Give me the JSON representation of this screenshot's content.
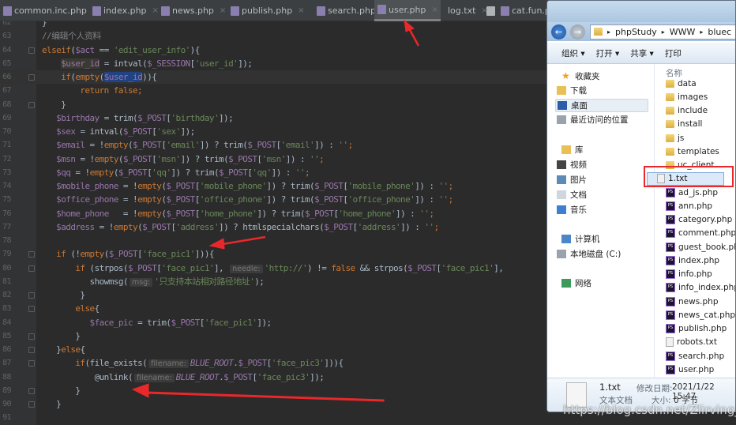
{
  "editor": {
    "tabs": [
      {
        "label": "common.inc.php",
        "type": "php",
        "active": false
      },
      {
        "label": "index.php",
        "type": "php",
        "active": false
      },
      {
        "label": "news.php",
        "type": "php",
        "active": false
      },
      {
        "label": "publish.php",
        "type": "php",
        "active": false
      },
      {
        "label": "search.php",
        "type": "php",
        "active": false
      },
      {
        "label": "user.php",
        "type": "php",
        "active": true
      },
      {
        "label": "log.txt",
        "type": "txt",
        "active": false
      },
      {
        "label": "cat.fun.p",
        "type": "php",
        "active": false
      }
    ],
    "current_line": 66,
    "lines": [
      {
        "n": "62",
        "t": [
          [
            "",
            "}"
          ]
        ]
      },
      {
        "n": "63",
        "t": [
          [
            "cm",
            "//编辑个人资料"
          ]
        ]
      },
      {
        "n": "64",
        "t": [
          [
            "kw",
            "elseif"
          ],
          [
            "",
            "("
          ],
          [
            "var",
            "$act"
          ],
          [
            "",
            " == "
          ],
          [
            "str",
            "'edit_user_info'"
          ],
          [
            "",
            "){"
          ]
        ]
      },
      {
        "n": "65",
        "t": [
          [
            "",
            "    "
          ],
          [
            "uvar",
            "$user_id"
          ],
          [
            "",
            " = intval("
          ],
          [
            "var",
            "$_SESSION"
          ],
          [
            "",
            "["
          ],
          [
            "str",
            "'user_id'"
          ],
          [
            "",
            "]);"
          ]
        ]
      },
      {
        "n": "66",
        "t": [
          [
            "",
            "    "
          ],
          [
            "kw",
            "if"
          ],
          [
            "",
            "("
          ],
          [
            "kw",
            "empty"
          ],
          [
            "",
            "("
          ],
          [
            "sel var",
            "$user_id"
          ],
          [
            "",
            ")){"
          ]
        ]
      },
      {
        "n": "67",
        "t": [
          [
            "",
            "        "
          ],
          [
            "kw",
            "return false;"
          ]
        ]
      },
      {
        "n": "68",
        "t": [
          [
            "",
            "    }"
          ]
        ]
      },
      {
        "n": "69",
        "t": [
          [
            "",
            "   "
          ],
          [
            "var",
            "$birthday"
          ],
          [
            "",
            " = trim("
          ],
          [
            "var",
            "$_POST"
          ],
          [
            "",
            "["
          ],
          [
            "str",
            "'birthday'"
          ],
          [
            "",
            "]);"
          ]
        ]
      },
      {
        "n": "70",
        "t": [
          [
            "",
            "   "
          ],
          [
            "var",
            "$sex"
          ],
          [
            "",
            " = intval("
          ],
          [
            "var",
            "$_POST"
          ],
          [
            "",
            "["
          ],
          [
            "str",
            "'sex'"
          ],
          [
            "",
            "]);"
          ]
        ]
      },
      {
        "n": "71",
        "t": [
          [
            "",
            "   "
          ],
          [
            "var",
            "$email"
          ],
          [
            "",
            " = !"
          ],
          [
            "kw",
            "empty"
          ],
          [
            "",
            "("
          ],
          [
            "var",
            "$_POST"
          ],
          [
            "",
            "["
          ],
          [
            "str",
            "'email'"
          ],
          [
            "",
            "]) ? trim("
          ],
          [
            "var",
            "$_POST"
          ],
          [
            "",
            "["
          ],
          [
            "str",
            "'email'"
          ],
          [
            "",
            "]) : "
          ],
          [
            "str",
            "''"
          ],
          [
            "kw",
            ";"
          ]
        ]
      },
      {
        "n": "72",
        "t": [
          [
            "",
            "   "
          ],
          [
            "var",
            "$msn"
          ],
          [
            "",
            " = !"
          ],
          [
            "kw",
            "empty"
          ],
          [
            "",
            "("
          ],
          [
            "var",
            "$_POST"
          ],
          [
            "",
            "["
          ],
          [
            "str",
            "'msn'"
          ],
          [
            "",
            "]) ? trim("
          ],
          [
            "var",
            "$_POST"
          ],
          [
            "",
            "["
          ],
          [
            "str",
            "'msn'"
          ],
          [
            "",
            "]) : "
          ],
          [
            "str",
            "''"
          ],
          [
            "kw",
            ";"
          ]
        ]
      },
      {
        "n": "73",
        "t": [
          [
            "",
            "   "
          ],
          [
            "var",
            "$qq"
          ],
          [
            "",
            " = !"
          ],
          [
            "kw",
            "empty"
          ],
          [
            "",
            "("
          ],
          [
            "var",
            "$_POST"
          ],
          [
            "",
            "["
          ],
          [
            "str",
            "'qq'"
          ],
          [
            "",
            "]) ? trim("
          ],
          [
            "var",
            "$_POST"
          ],
          [
            "",
            "["
          ],
          [
            "str",
            "'qq'"
          ],
          [
            "",
            "]) : "
          ],
          [
            "str",
            "''"
          ],
          [
            "kw",
            ";"
          ]
        ]
      },
      {
        "n": "74",
        "t": [
          [
            "",
            "   "
          ],
          [
            "var",
            "$mobile_phone"
          ],
          [
            "",
            " = !"
          ],
          [
            "kw",
            "empty"
          ],
          [
            "",
            "("
          ],
          [
            "var",
            "$_POST"
          ],
          [
            "",
            "["
          ],
          [
            "str",
            "'mobile_phone'"
          ],
          [
            "",
            "]) ? trim("
          ],
          [
            "var",
            "$_POST"
          ],
          [
            "",
            "["
          ],
          [
            "str",
            "'mobile_phone'"
          ],
          [
            "",
            "]) : "
          ],
          [
            "str",
            "''"
          ],
          [
            "kw",
            ";"
          ]
        ]
      },
      {
        "n": "75",
        "t": [
          [
            "",
            "   "
          ],
          [
            "var",
            "$office_phone"
          ],
          [
            "",
            " = !"
          ],
          [
            "kw",
            "empty"
          ],
          [
            "",
            "("
          ],
          [
            "var",
            "$_POST"
          ],
          [
            "",
            "["
          ],
          [
            "str",
            "'office_phone'"
          ],
          [
            "",
            "]) ? trim("
          ],
          [
            "var",
            "$_POST"
          ],
          [
            "",
            "["
          ],
          [
            "str",
            "'office_phone'"
          ],
          [
            "",
            "]) : "
          ],
          [
            "str",
            "''"
          ],
          [
            "kw",
            ";"
          ]
        ]
      },
      {
        "n": "76",
        "t": [
          [
            "",
            "   "
          ],
          [
            "var",
            "$home_phone"
          ],
          [
            "",
            "   = !"
          ],
          [
            "kw",
            "empty"
          ],
          [
            "",
            "("
          ],
          [
            "var",
            "$_POST"
          ],
          [
            "",
            "["
          ],
          [
            "str",
            "'home_phone'"
          ],
          [
            "",
            "]) ? trim("
          ],
          [
            "var",
            "$_POST"
          ],
          [
            "",
            "["
          ],
          [
            "str",
            "'home_phone'"
          ],
          [
            "",
            "]) : "
          ],
          [
            "str",
            "''"
          ],
          [
            "kw",
            ";"
          ]
        ]
      },
      {
        "n": "77",
        "t": [
          [
            "",
            "   "
          ],
          [
            "var",
            "$address"
          ],
          [
            "",
            " = !"
          ],
          [
            "kw",
            "empty"
          ],
          [
            "",
            "("
          ],
          [
            "var",
            "$_POST"
          ],
          [
            "",
            "["
          ],
          [
            "str",
            "'address'"
          ],
          [
            "",
            "]) ? htmlspecialchars("
          ],
          [
            "var",
            "$_POST"
          ],
          [
            "",
            "["
          ],
          [
            "str",
            "'address'"
          ],
          [
            "",
            "]) : "
          ],
          [
            "str",
            "''"
          ],
          [
            "kw",
            ";"
          ]
        ]
      },
      {
        "n": "78",
        "t": []
      },
      {
        "n": "79",
        "t": [
          [
            "",
            "   "
          ],
          [
            "kw",
            "if"
          ],
          [
            "",
            " (!"
          ],
          [
            "kw",
            "empty"
          ],
          [
            "",
            "("
          ],
          [
            "var",
            "$_POST"
          ],
          [
            "",
            "["
          ],
          [
            "str",
            "'face_pic1'"
          ],
          [
            "",
            "])){"
          ]
        ]
      },
      {
        "n": "80",
        "t": [
          [
            "",
            "       "
          ],
          [
            "kw",
            "if"
          ],
          [
            "",
            " (strpos("
          ],
          [
            "var",
            "$_POST"
          ],
          [
            "",
            "["
          ],
          [
            "str",
            "'face_pic1'"
          ],
          [
            "",
            "], "
          ],
          [
            "hint",
            "needle:"
          ],
          [
            "str",
            "'http://'"
          ],
          [
            "",
            ") != "
          ],
          [
            "kw",
            "false"
          ],
          [
            "",
            " && strpos("
          ],
          [
            "var",
            "$_POST"
          ],
          [
            "",
            "["
          ],
          [
            "str",
            "'face_pic1'"
          ],
          [
            "",
            "],"
          ]
        ]
      },
      {
        "n": "81",
        "t": [
          [
            "",
            "          showmsg("
          ],
          [
            "hint",
            "msg:"
          ],
          [
            "str",
            "'只支持本站相对路径地址'"
          ],
          [
            "",
            ");"
          ]
        ]
      },
      {
        "n": "82",
        "t": [
          [
            "",
            "        }"
          ]
        ]
      },
      {
        "n": "83",
        "t": [
          [
            "",
            "       "
          ],
          [
            "kw",
            "else"
          ],
          [
            "",
            "{"
          ]
        ]
      },
      {
        "n": "84",
        "t": [
          [
            "",
            "          "
          ],
          [
            "var",
            "$face_pic"
          ],
          [
            "",
            " = trim("
          ],
          [
            "var",
            "$_POST"
          ],
          [
            "",
            "["
          ],
          [
            "str",
            "'face_pic1'"
          ],
          [
            "",
            "]);"
          ]
        ]
      },
      {
        "n": "85",
        "t": [
          [
            "",
            "       }"
          ]
        ]
      },
      {
        "n": "86",
        "t": [
          [
            "",
            "   }"
          ],
          [
            "kw",
            "else"
          ],
          [
            "",
            "{"
          ]
        ]
      },
      {
        "n": "87",
        "t": [
          [
            "",
            "       "
          ],
          [
            "kw",
            "if"
          ],
          [
            "",
            "(file_exists("
          ],
          [
            "hint",
            "filename:"
          ],
          [
            "const",
            "BLUE_ROOT"
          ],
          [
            "",
            "."
          ],
          [
            "var",
            "$_POST"
          ],
          [
            "",
            "["
          ],
          [
            "str",
            "'face_pic3'"
          ],
          [
            "",
            "])){"
          ]
        ]
      },
      {
        "n": "88",
        "t": [
          [
            "",
            "           @unlink("
          ],
          [
            "hint",
            "filename:"
          ],
          [
            "const",
            "BLUE_ROOT"
          ],
          [
            "",
            "."
          ],
          [
            "var",
            "$_POST"
          ],
          [
            "",
            "["
          ],
          [
            "str",
            "'face_pic3'"
          ],
          [
            "",
            "]);"
          ]
        ]
      },
      {
        "n": "89",
        "t": [
          [
            "",
            "       }"
          ]
        ]
      },
      {
        "n": "90",
        "t": [
          [
            "",
            "   }"
          ]
        ]
      },
      {
        "n": "91",
        "t": []
      }
    ]
  },
  "explorer": {
    "path": [
      "phpStudy",
      "WWW",
      "bluec"
    ],
    "toolbar": [
      "组织 ▾",
      "打开 ▾",
      "共享 ▾",
      "打印"
    ],
    "nav": [
      {
        "label": "收藏夹",
        "icon": "star-icon",
        "level": 0
      },
      {
        "label": "下载",
        "icon": "download-folder-icon",
        "level": 1
      },
      {
        "label": "桌面",
        "icon": "desktop-icon",
        "level": 1,
        "selected": true
      },
      {
        "label": "最近访问的位置",
        "icon": "recent-places-icon",
        "level": 1
      },
      {
        "label": "库",
        "icon": "library-icon",
        "level": 0
      },
      {
        "label": "视频",
        "icon": "video-icon",
        "level": 1
      },
      {
        "label": "图片",
        "icon": "pictures-icon",
        "level": 1
      },
      {
        "label": "文档",
        "icon": "documents-icon",
        "level": 1
      },
      {
        "label": "音乐",
        "icon": "music-icon",
        "level": 1
      },
      {
        "label": "计算机",
        "icon": "computer-icon",
        "level": 0
      },
      {
        "label": "本地磁盘 (C:)",
        "icon": "disk-icon",
        "level": 1
      },
      {
        "label": "网络",
        "icon": "network-icon",
        "level": 0
      }
    ],
    "column_header": "名称",
    "files": [
      {
        "name": "data",
        "type": "folder"
      },
      {
        "name": "images",
        "type": "folder"
      },
      {
        "name": "include",
        "type": "folder"
      },
      {
        "name": "install",
        "type": "folder"
      },
      {
        "name": "js",
        "type": "folder"
      },
      {
        "name": "templates",
        "type": "folder"
      },
      {
        "name": "uc_client",
        "type": "folder"
      },
      {
        "name": "1.txt",
        "type": "txt",
        "selected": true
      },
      {
        "name": "ad_js.php",
        "type": "php"
      },
      {
        "name": "ann.php",
        "type": "php"
      },
      {
        "name": "category.php",
        "type": "php"
      },
      {
        "name": "comment.php",
        "type": "php"
      },
      {
        "name": "guest_book.php",
        "type": "php"
      },
      {
        "name": "index.php",
        "type": "php"
      },
      {
        "name": "info.php",
        "type": "php"
      },
      {
        "name": "info_index.php",
        "type": "php"
      },
      {
        "name": "news.php",
        "type": "php"
      },
      {
        "name": "news_cat.php",
        "type": "php"
      },
      {
        "name": "publish.php",
        "type": "php"
      },
      {
        "name": "robots.txt",
        "type": "txt"
      },
      {
        "name": "search.php",
        "type": "php"
      },
      {
        "name": "user.php",
        "type": "php"
      }
    ],
    "status": {
      "name": "1.txt",
      "type": "文本文档",
      "modified_label": "修改日期:",
      "modified": "2021/1/22 15:47",
      "size_label": "大小:",
      "size": "0 字节"
    }
  },
  "watermark": "https://blog.csdn.net/Zlirving_",
  "colors": {
    "editor_bg": "#2b2b2b",
    "keyword": "#cc7832",
    "variable": "#9876aa",
    "string": "#6a8759",
    "annotation": "#e8282b"
  }
}
